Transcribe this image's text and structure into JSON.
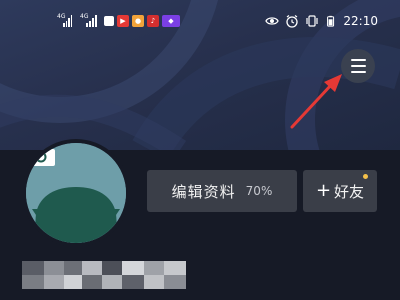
{
  "status_bar": {
    "network_1": "4G",
    "network_2": "4G",
    "time": "22:10"
  },
  "profile": {
    "edit_profile_label": "编辑资料",
    "profile_completion": "70%",
    "add_friend_label": "好友",
    "add_friend_prefix": "+"
  },
  "colors": {
    "background": "#161a26",
    "banner": "#27304d",
    "button_bg": "#3a3e48",
    "annotation_arrow": "#e53935",
    "notification_dot": "#f5c14a"
  },
  "icons": {
    "menu": "hamburger-menu-icon",
    "camera": "camera-icon",
    "add": "plus-icon"
  }
}
